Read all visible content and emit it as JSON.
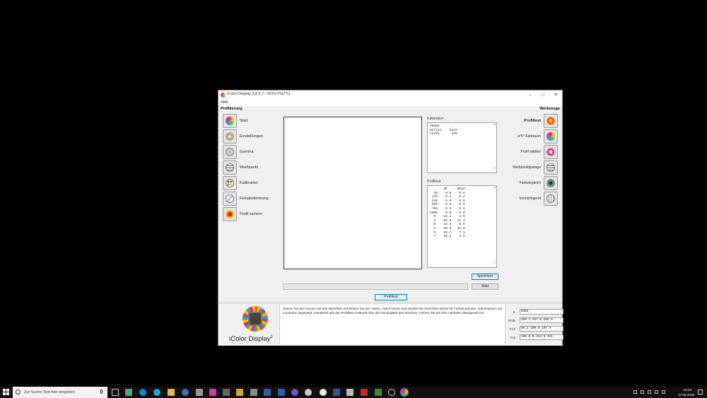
{
  "window": {
    "title": "iColor Display 3.8.5.7 - ROG PG27U",
    "menu_help": "Hilfe"
  },
  "left": {
    "heading": "Profilierung",
    "items": [
      {
        "label": "Start",
        "icon": "color-wheel-icon"
      },
      {
        "label": "Einstellungen",
        "icon": "settings-dial-icon"
      },
      {
        "label": "Gamma",
        "icon": "gamma-circle-icon"
      },
      {
        "label": "Weißpunkt",
        "icon": "whitepoint-list-icon"
      },
      {
        "label": "Kalibration",
        "icon": "calibration-dots-icon"
      },
      {
        "label": "Feinabstimmung",
        "icon": "fine-tune-icon"
      },
      {
        "label": "Profil sichern",
        "icon": "save-profile-icon"
      }
    ]
  },
  "right": {
    "heading": "Werkzeuge",
    "items": [
      {
        "label": "Profiltest",
        "icon": "profile-test-icon"
      },
      {
        "label": "a*b*-Farbraum",
        "icon": "color-space-icon"
      },
      {
        "label": "Profil wählen",
        "icon": "select-profile-icon"
      },
      {
        "label": "Weißpunktjustage",
        "icon": "whitepoint-adjust-icon"
      },
      {
        "label": "Farbvergleich",
        "icon": "color-compare-icon"
      },
      {
        "label": "Vormichtgerät",
        "icon": "device-icon"
      }
    ]
  },
  "calibration": {
    "label": "Kalibration",
    "rows": [
      "Gamma      -",
      "Kelvin    6415",
      "cd/m2      160"
    ]
  },
  "profiltest": {
    "label": "Profiltest",
    "rows": [
      "       dE     dE94",
      "  5%    0.8    0.8",
      " 17%    0.4    0.4",
      " 26%    0.6    0.6",
      " 50%    0.9    0.9",
      " 75%    0.5    0.5",
      "100%    0.0    0.0",
      "  R    10.1    4.9",
      "  G    56.4   11.3",
      "  B    18.4    6.5",
      "  C    40.5   11.0",
      "  M    19.7    7.1",
      "  Y    10.3    3.5"
    ]
  },
  "buttons": {
    "save": "Speichern",
    "start": "Start",
    "profiltest": "Profiltest"
  },
  "info_text": "Setzen Sie den Sensor auf das Messfeld und klicken Sie auf »Start«. Nach kurzer Zeit werden die erreichten Werte für Farbtemperatur, Gammawert und Luminanz angezeigt. Zusätzlich gibt der Profiltest Auskunft über die Genauigkeit des Monitors. Fahren Sie mit dem nächsten Menüpunkt fort.",
  "logo": {
    "text": "iColor Display",
    "sup": "3"
  },
  "measurements": [
    {
      "key": "K",
      "value": "6403"
    },
    {
      "key": "RGB",
      "value": "250.4 257.0 256.0"
    },
    {
      "key": "XYZ",
      "value": "95.1 100.0 107.4"
    },
    {
      "key": "Yxy",
      "value": "100.0 0.314 0.331"
    }
  ],
  "taskbar": {
    "search_placeholder": "Zur Suche Text hier eingeben",
    "time": "16:23",
    "date": "17.08.2018"
  }
}
